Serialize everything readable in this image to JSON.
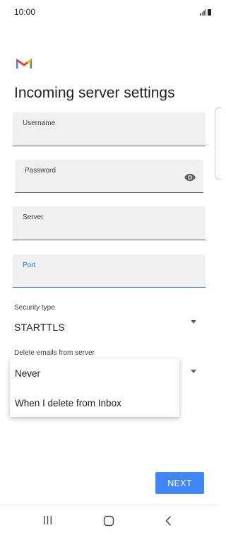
{
  "status_bar": {
    "time": "10:00"
  },
  "header": {
    "title": "Incoming server settings"
  },
  "fields": {
    "username": {
      "label": "Username"
    },
    "password": {
      "label": "Password"
    },
    "server": {
      "label": "Server"
    },
    "port": {
      "label": "Port"
    }
  },
  "security": {
    "label": "Security type",
    "value": "STARTTLS"
  },
  "delete_emails": {
    "label": "Delete emails from server",
    "options": [
      "Never",
      "When I delete from Inbox"
    ]
  },
  "actions": {
    "next_label": "NEXT"
  },
  "colors": {
    "accent": "#1a73e8",
    "button": "#4285f4",
    "field_bg": "#eef0f2"
  },
  "icons": {
    "app_logo": "gmail-logo",
    "password_toggle": "eye-icon",
    "dropdown": "triangle-down-icon",
    "nav": [
      "recent-apps-icon",
      "home-icon",
      "back-icon"
    ]
  }
}
